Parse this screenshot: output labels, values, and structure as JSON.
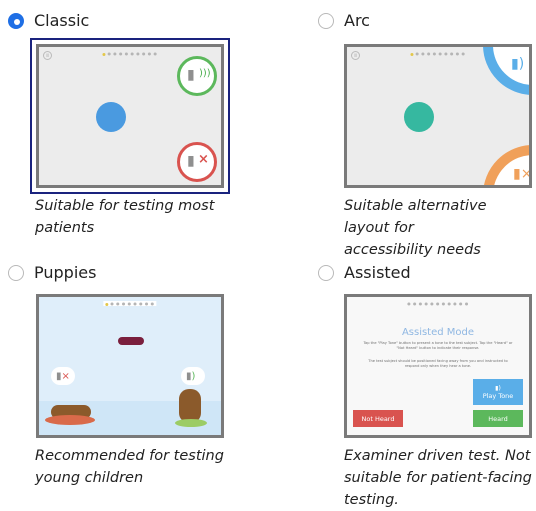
{
  "options": [
    {
      "label": "Classic",
      "selected": true,
      "description_lines": [
        "Suitable for testing most",
        "patients"
      ]
    },
    {
      "label": "Arc",
      "selected": false,
      "description_lines": [
        "Suitable alternative layout for",
        "accessibility needs"
      ]
    },
    {
      "label": "Puppies",
      "selected": false,
      "description_lines": [
        "Recommended for testing",
        "young children"
      ]
    },
    {
      "label": "Assisted",
      "selected": false,
      "description_lines": [
        "Examiner driven test. Not",
        "suitable for patient-facing",
        "testing."
      ]
    }
  ],
  "assisted_preview": {
    "title": "Assisted Mode",
    "instructions": "Tap the \"Play Tone\" button to present a tone to the test subject. Tap the \"Heard\" or \"Not Heard\" button to indicate their response.",
    "note": "The test subject should be positioned facing away from you and instructed to respond only when they hear a tone.",
    "not_heard_label": "Not Heard",
    "heard_label": "Heard",
    "play_tone_label": "Play Tone"
  },
  "colors": {
    "selected_radio": "#1f6fe5",
    "selected_frame": "#1a237e",
    "classic_ball": "#4a9ae0",
    "arc_ball": "#36b8a0",
    "heard_green": "#5cb85c",
    "not_heard_red": "#d9534f",
    "play_tone_blue": "#5aaee8"
  },
  "icons": [
    "speaker-heard-icon",
    "speaker-muted-icon",
    "bone-icon",
    "puppy-icon",
    "pause-icon"
  ]
}
